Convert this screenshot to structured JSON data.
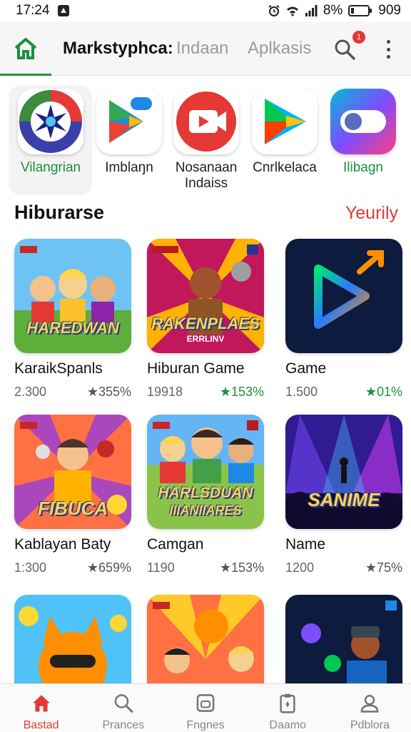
{
  "status_bar": {
    "time": "17:24",
    "battery_percent": "8%",
    "extra": "909",
    "icons": [
      "alarm-icon",
      "wifi-icon",
      "signal-icon",
      "battery-icon"
    ]
  },
  "app_bar": {
    "title": "Markstyphca:",
    "tabs": [
      {
        "label": "Indaan"
      },
      {
        "label": "Aplkasis"
      }
    ],
    "notification_count": "1",
    "accent_color": "#1e8e3e"
  },
  "featured_apps": [
    {
      "label": "Vilangrian",
      "icon": "compass-star-icon"
    },
    {
      "label": "Imblaŋn",
      "icon": "play-store-icon"
    },
    {
      "label": "Nosanaan Indaiss",
      "icon": "video-player-icon"
    },
    {
      "label": "Cnrlkelaca",
      "icon": "play-triangle-icon"
    },
    {
      "label": "Ilibagn",
      "icon": "toggle-icon"
    }
  ],
  "section": {
    "title": "Hiburarse",
    "link": "Yeurily"
  },
  "games": [
    {
      "name": "KaraikSpanls",
      "downloads": "2.300",
      "rating": "★355%",
      "rating_green": false,
      "thumb_title": "HAREDWAN",
      "thumb_subtitle": ""
    },
    {
      "name": "Hiburan Game",
      "downloads": "19918",
      "rating": "★153%",
      "rating_green": true,
      "thumb_title": "RAKENPLAES",
      "thumb_subtitle": "ERRLINV"
    },
    {
      "name": "Game",
      "downloads": "1.500",
      "rating": "★01%",
      "rating_green": true,
      "thumb_title": "",
      "thumb_subtitle": ""
    },
    {
      "name": "Kablayan Baty",
      "downloads": "1:300",
      "rating": "★659%",
      "rating_green": false,
      "thumb_title": "FIBUCA",
      "thumb_subtitle": ""
    },
    {
      "name": "Camgan",
      "downloads": "1190",
      "rating": "★153%",
      "rating_green": false,
      "thumb_title": "HARLSDUAN",
      "thumb_subtitle": "IIIANIIARES"
    },
    {
      "name": "Name",
      "downloads": "1200",
      "rating": "★75%",
      "rating_green": false,
      "thumb_title": "SANIME",
      "thumb_subtitle": ""
    }
  ],
  "bottom_nav": [
    {
      "label": "Bastad",
      "icon": "home-icon",
      "active": true
    },
    {
      "label": "Prances",
      "icon": "search-icon",
      "active": false
    },
    {
      "label": "Fngnes",
      "icon": "gamepad-icon",
      "active": false
    },
    {
      "label": "Daamo",
      "icon": "clipboard-icon",
      "active": false
    },
    {
      "label": "Pdblora",
      "icon": "profile-icon",
      "active": false
    }
  ]
}
